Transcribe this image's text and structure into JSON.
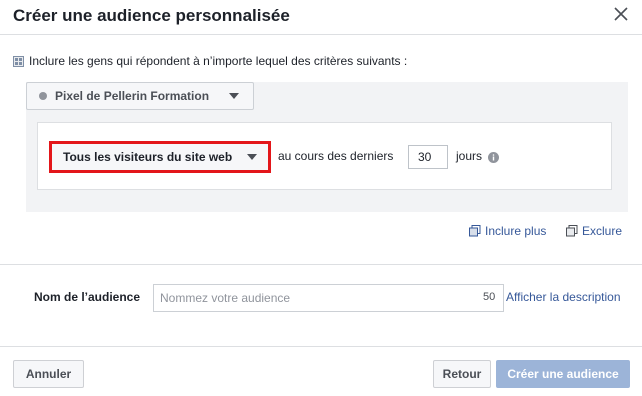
{
  "dialog": {
    "title": "Créer une audience personnalisée",
    "include_text": "Inclure les gens qui répondent à n’importe lequel des critères suivants :"
  },
  "pixel": {
    "label": "Pixel de Pellerin Formation"
  },
  "rule": {
    "visitors_label": "Tous les visiteurs du site web",
    "during_label": "au cours des derniers",
    "days_value": "30",
    "days_unit": "jours"
  },
  "actions": {
    "include_more": "Inclure plus",
    "exclude": "Exclure"
  },
  "audience_name": {
    "label": "Nom de l’audience",
    "placeholder": "Nommez votre audience",
    "char_count": "50",
    "description_link": "Afficher la description"
  },
  "footer": {
    "cancel": "Annuler",
    "back": "Retour",
    "create": "Créer une audience"
  },
  "colors": {
    "link": "#365899",
    "highlight_border": "#e3161a",
    "primary_disabled": "#9cb4d8"
  }
}
